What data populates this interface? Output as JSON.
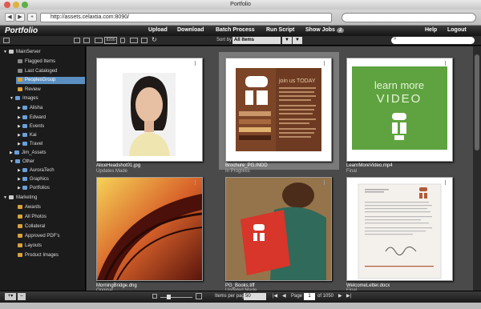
{
  "window": {
    "title": "Portfolio"
  },
  "browser": {
    "url": "http://assets.celaxtia.com:8090/",
    "search_placeholder": ""
  },
  "app": {
    "logo": "Portfolio",
    "menu": [
      {
        "label": "Upload"
      },
      {
        "label": "Download"
      },
      {
        "label": "Batch Process"
      },
      {
        "label": "Run Script"
      },
      {
        "label": "Show Jobs"
      }
    ],
    "jobs_count": "2",
    "help": "Help",
    "logout": "Logout"
  },
  "toolbar": {
    "sort_label": "Sort by",
    "sort_value": "All Items",
    "counter": "8200"
  },
  "sidebar": {
    "items": [
      {
        "label": "MainServer"
      },
      {
        "label": "Flagged Items"
      },
      {
        "label": "Last Cataloged"
      },
      {
        "label": "PeoplesGroup"
      },
      {
        "label": "Review"
      },
      {
        "label": "Images"
      },
      {
        "label": "Alisha"
      },
      {
        "label": "Edward"
      },
      {
        "label": "Events"
      },
      {
        "label": "Kai"
      },
      {
        "label": "Travel"
      },
      {
        "label": "Jim_Assets"
      },
      {
        "label": "Other"
      },
      {
        "label": "AuroraTech"
      },
      {
        "label": "Graphics"
      },
      {
        "label": "Portfolios"
      },
      {
        "label": "Marketing"
      },
      {
        "label": "Awards"
      },
      {
        "label": "All Photos"
      },
      {
        "label": "Collateral"
      },
      {
        "label": "Approved PDF's"
      },
      {
        "label": "Layouts"
      },
      {
        "label": "Product Images"
      }
    ]
  },
  "assets": [
    {
      "name": "AliceHeadshot01.jpg",
      "status": "Updates Made"
    },
    {
      "name": "Brochure_PG.INDD",
      "status": "In Progress"
    },
    {
      "name": "LearnMoreVideo.mp4",
      "status": "Final"
    },
    {
      "name": "MorningBridge.dng",
      "status": "Original"
    },
    {
      "name": "PG_Books.tiff",
      "status": "Updated Made"
    },
    {
      "name": "WelcomeLetter.docx",
      "status": "Final"
    }
  ],
  "thumb_text": {
    "brochure_heading": "join us TODAY",
    "video_line1": "learn more",
    "video_line2": "VIDEO"
  },
  "pagination": {
    "per_page_label": "Items per page:",
    "per_page": "50",
    "page_label": "Page",
    "page": "1",
    "of_label": "of 1050"
  },
  "colors": {
    "accent": "#5b8fc1",
    "brochure": "#6e3b22",
    "video_green": "#5ea33f",
    "book_red": "#d8352b"
  }
}
